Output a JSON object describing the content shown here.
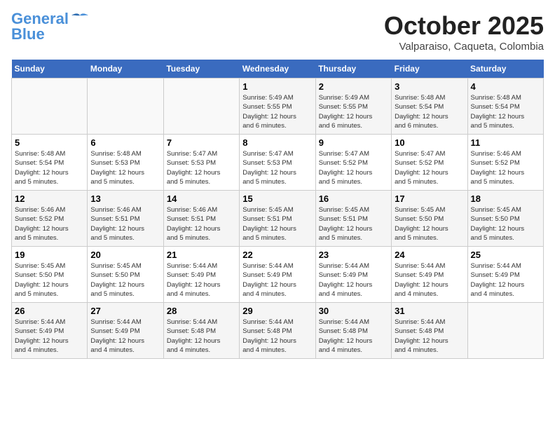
{
  "logo": {
    "line1": "General",
    "line2": "Blue"
  },
  "title": "October 2025",
  "subtitle": "Valparaiso, Caqueta, Colombia",
  "days_of_week": [
    "Sunday",
    "Monday",
    "Tuesday",
    "Wednesday",
    "Thursday",
    "Friday",
    "Saturday"
  ],
  "weeks": [
    [
      {
        "day": "",
        "info": ""
      },
      {
        "day": "",
        "info": ""
      },
      {
        "day": "",
        "info": ""
      },
      {
        "day": "1",
        "info": "Sunrise: 5:49 AM\nSunset: 5:55 PM\nDaylight: 12 hours\nand 6 minutes."
      },
      {
        "day": "2",
        "info": "Sunrise: 5:49 AM\nSunset: 5:55 PM\nDaylight: 12 hours\nand 6 minutes."
      },
      {
        "day": "3",
        "info": "Sunrise: 5:48 AM\nSunset: 5:54 PM\nDaylight: 12 hours\nand 6 minutes."
      },
      {
        "day": "4",
        "info": "Sunrise: 5:48 AM\nSunset: 5:54 PM\nDaylight: 12 hours\nand 5 minutes."
      }
    ],
    [
      {
        "day": "5",
        "info": "Sunrise: 5:48 AM\nSunset: 5:54 PM\nDaylight: 12 hours\nand 5 minutes."
      },
      {
        "day": "6",
        "info": "Sunrise: 5:48 AM\nSunset: 5:53 PM\nDaylight: 12 hours\nand 5 minutes."
      },
      {
        "day": "7",
        "info": "Sunrise: 5:47 AM\nSunset: 5:53 PM\nDaylight: 12 hours\nand 5 minutes."
      },
      {
        "day": "8",
        "info": "Sunrise: 5:47 AM\nSunset: 5:53 PM\nDaylight: 12 hours\nand 5 minutes."
      },
      {
        "day": "9",
        "info": "Sunrise: 5:47 AM\nSunset: 5:52 PM\nDaylight: 12 hours\nand 5 minutes."
      },
      {
        "day": "10",
        "info": "Sunrise: 5:47 AM\nSunset: 5:52 PM\nDaylight: 12 hours\nand 5 minutes."
      },
      {
        "day": "11",
        "info": "Sunrise: 5:46 AM\nSunset: 5:52 PM\nDaylight: 12 hours\nand 5 minutes."
      }
    ],
    [
      {
        "day": "12",
        "info": "Sunrise: 5:46 AM\nSunset: 5:52 PM\nDaylight: 12 hours\nand 5 minutes."
      },
      {
        "day": "13",
        "info": "Sunrise: 5:46 AM\nSunset: 5:51 PM\nDaylight: 12 hours\nand 5 minutes."
      },
      {
        "day": "14",
        "info": "Sunrise: 5:46 AM\nSunset: 5:51 PM\nDaylight: 12 hours\nand 5 minutes."
      },
      {
        "day": "15",
        "info": "Sunrise: 5:45 AM\nSunset: 5:51 PM\nDaylight: 12 hours\nand 5 minutes."
      },
      {
        "day": "16",
        "info": "Sunrise: 5:45 AM\nSunset: 5:51 PM\nDaylight: 12 hours\nand 5 minutes."
      },
      {
        "day": "17",
        "info": "Sunrise: 5:45 AM\nSunset: 5:50 PM\nDaylight: 12 hours\nand 5 minutes."
      },
      {
        "day": "18",
        "info": "Sunrise: 5:45 AM\nSunset: 5:50 PM\nDaylight: 12 hours\nand 5 minutes."
      }
    ],
    [
      {
        "day": "19",
        "info": "Sunrise: 5:45 AM\nSunset: 5:50 PM\nDaylight: 12 hours\nand 5 minutes."
      },
      {
        "day": "20",
        "info": "Sunrise: 5:45 AM\nSunset: 5:50 PM\nDaylight: 12 hours\nand 5 minutes."
      },
      {
        "day": "21",
        "info": "Sunrise: 5:44 AM\nSunset: 5:49 PM\nDaylight: 12 hours\nand 4 minutes."
      },
      {
        "day": "22",
        "info": "Sunrise: 5:44 AM\nSunset: 5:49 PM\nDaylight: 12 hours\nand 4 minutes."
      },
      {
        "day": "23",
        "info": "Sunrise: 5:44 AM\nSunset: 5:49 PM\nDaylight: 12 hours\nand 4 minutes."
      },
      {
        "day": "24",
        "info": "Sunrise: 5:44 AM\nSunset: 5:49 PM\nDaylight: 12 hours\nand 4 minutes."
      },
      {
        "day": "25",
        "info": "Sunrise: 5:44 AM\nSunset: 5:49 PM\nDaylight: 12 hours\nand 4 minutes."
      }
    ],
    [
      {
        "day": "26",
        "info": "Sunrise: 5:44 AM\nSunset: 5:49 PM\nDaylight: 12 hours\nand 4 minutes."
      },
      {
        "day": "27",
        "info": "Sunrise: 5:44 AM\nSunset: 5:49 PM\nDaylight: 12 hours\nand 4 minutes."
      },
      {
        "day": "28",
        "info": "Sunrise: 5:44 AM\nSunset: 5:48 PM\nDaylight: 12 hours\nand 4 minutes."
      },
      {
        "day": "29",
        "info": "Sunrise: 5:44 AM\nSunset: 5:48 PM\nDaylight: 12 hours\nand 4 minutes."
      },
      {
        "day": "30",
        "info": "Sunrise: 5:44 AM\nSunset: 5:48 PM\nDaylight: 12 hours\nand 4 minutes."
      },
      {
        "day": "31",
        "info": "Sunrise: 5:44 AM\nSunset: 5:48 PM\nDaylight: 12 hours\nand 4 minutes."
      },
      {
        "day": "",
        "info": ""
      }
    ]
  ]
}
